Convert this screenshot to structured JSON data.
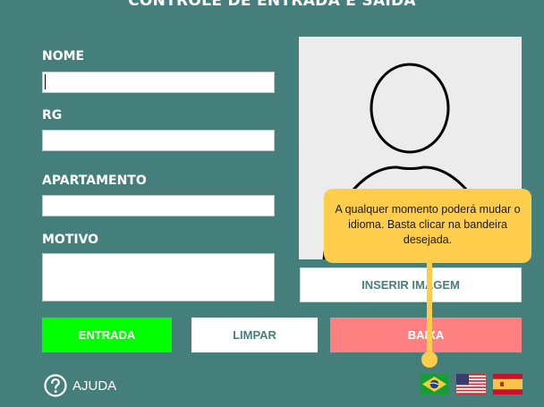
{
  "form": {
    "title": "CONTROLE DE ENTRADA E SAÍDA",
    "fields": {
      "nome_label": "NOME",
      "nome_value": "",
      "rg_label": "RG",
      "rg_value": "",
      "apartamento_label": "APARTAMENTO",
      "apartamento_value": "",
      "motivo_label": "MOTIVO",
      "motivo_value": ""
    }
  },
  "photo": {
    "icon": "user-silhouette-icon",
    "insert_label": "INSERIR IMAGEM"
  },
  "buttons": {
    "entrada": "ENTRADA",
    "limpar": "LIMPAR",
    "baixa": "BAIXA"
  },
  "help": {
    "label": "AJUDA",
    "icon": "question-circle-icon"
  },
  "languages": {
    "flags": [
      "brazil-flag",
      "usa-flag",
      "spain-flag"
    ]
  },
  "tooltip": {
    "text": "A qualquer  momento poderá mudar o idioma. Basta clicar na bandeira desejada."
  },
  "colors": {
    "background": "#457f7c",
    "entrada": "#00ff00",
    "baixa": "#ff8080",
    "tooltip": "#fdcd4b"
  }
}
